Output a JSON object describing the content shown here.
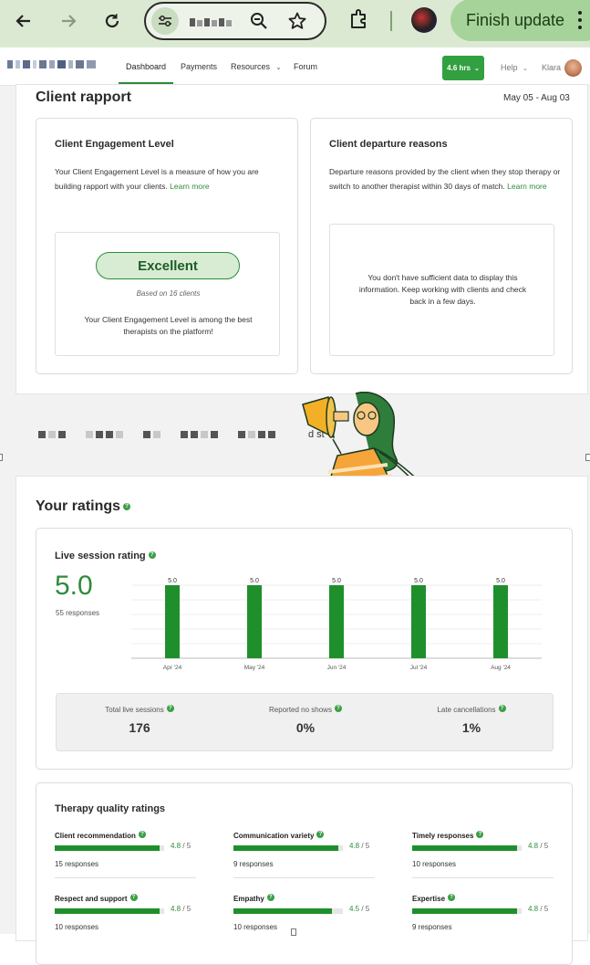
{
  "browser": {
    "finish_label": "Finish update"
  },
  "nav": {
    "links": [
      "Dashboard",
      "Payments",
      "Resources",
      "Forum"
    ],
    "hours": "4.6 hrs",
    "help": "Help",
    "user": "Klara"
  },
  "rapport": {
    "title": "Client rapport",
    "date_range": "May 05 - Aug 03",
    "engagement": {
      "title": "Client Engagement Level",
      "desc": "Your Client Engagement Level is a measure of how you are building rapport with your clients.",
      "link": "Learn more",
      "level": "Excellent",
      "based_on": "Based on 16 clients",
      "summary": "Your Client Engagement Level is among the best therapists on the platform!"
    },
    "departure": {
      "title": "Client departure reasons",
      "desc": "Departure reasons provided by the client when they stop therapy or switch to another therapist within 30 days of match.",
      "link": "Learn more",
      "empty": "You don't have sufficient data to display this information. Keep working with clients and check back in a few days."
    }
  },
  "banner_fragment": "d st",
  "ratings": {
    "title": "Your ratings",
    "live": {
      "title": "Live session rating",
      "score": "5.0",
      "responses": "55 responses"
    },
    "stats": [
      {
        "label": "Total live sessions",
        "value": "176"
      },
      {
        "label": "Reported no shows",
        "value": "0%"
      },
      {
        "label": "Late cancellations",
        "value": "1%"
      }
    ],
    "quality": {
      "title": "Therapy quality ratings",
      "items": [
        {
          "label": "Client recommendation",
          "score": "4.8",
          "den": " / 5",
          "fraction": 0.96,
          "responses": "15 responses"
        },
        {
          "label": "Communication variety",
          "score": "4.8",
          "den": " / 5",
          "fraction": 0.96,
          "responses": "9 responses"
        },
        {
          "label": "Timely responses",
          "score": "4.8",
          "den": " / 5",
          "fraction": 0.96,
          "responses": "10 responses"
        },
        {
          "label": "Respect and support",
          "score": "4.8",
          "den": " / 5",
          "fraction": 0.96,
          "responses": "10 responses"
        },
        {
          "label": "Empathy",
          "score": "4.5",
          "den": " / 5",
          "fraction": 0.9,
          "responses": "10 responses"
        },
        {
          "label": "Expertise",
          "score": "4.8",
          "den": " / 5",
          "fraction": 0.96,
          "responses": "9 responses"
        }
      ]
    }
  },
  "chart_data": {
    "type": "bar",
    "categories": [
      "Apr '24",
      "May '24",
      "Jun '24",
      "Jul '24",
      "Aug '24"
    ],
    "values": [
      5.0,
      5.0,
      5.0,
      5.0,
      5.0
    ],
    "data_labels": [
      "5.0",
      "5.0",
      "5.0",
      "5.0",
      "5.0"
    ],
    "ylim": [
      0,
      5
    ],
    "grid": true,
    "bar_color": "#1f8f2c"
  },
  "colors": {
    "accent": "#2e8b3a",
    "chrome": "#dbe9d3"
  }
}
